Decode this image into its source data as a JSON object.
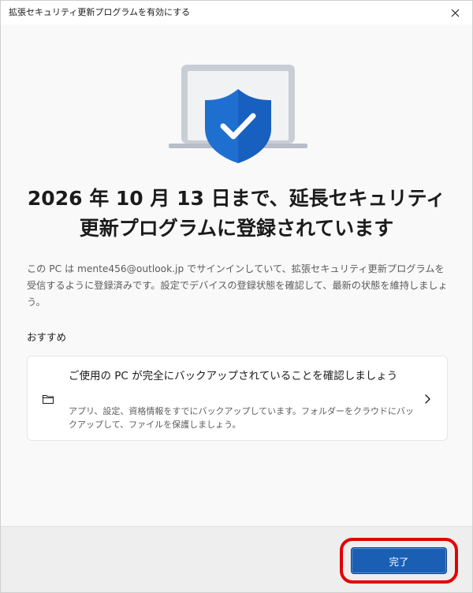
{
  "window": {
    "title": "拡張セキュリティ更新プログラムを有効にする"
  },
  "hero": {
    "icon": "laptop-shield-check-icon",
    "colors": {
      "shield": "#1f6fd1",
      "laptop": "#c9ced6",
      "check": "#ffffff"
    }
  },
  "headline": "2026 年 10 月 13 日まで、延長セキュリティ更新プログラムに登録されています",
  "description": "この PC は mente456@outlook.jp でサインインしていて、拡張セキュリティ更新プログラムを受信するように登録済みです。設定でデバイスの登録状態を確認して、最新の状態を維持しましょう。",
  "recommended": {
    "label": "おすすめ",
    "card": {
      "icon": "folder-icon",
      "title": "ご使用の PC が完全にバックアップされていることを確認しましょう",
      "body": "アプリ、設定、資格情報をすでにバックアップしています。フォルダーをクラウドにバックアップして、ファイルを保護しましょう。"
    }
  },
  "footer": {
    "done_label": "完了",
    "accent": "#1b5fb5",
    "highlight": "#e30000"
  }
}
